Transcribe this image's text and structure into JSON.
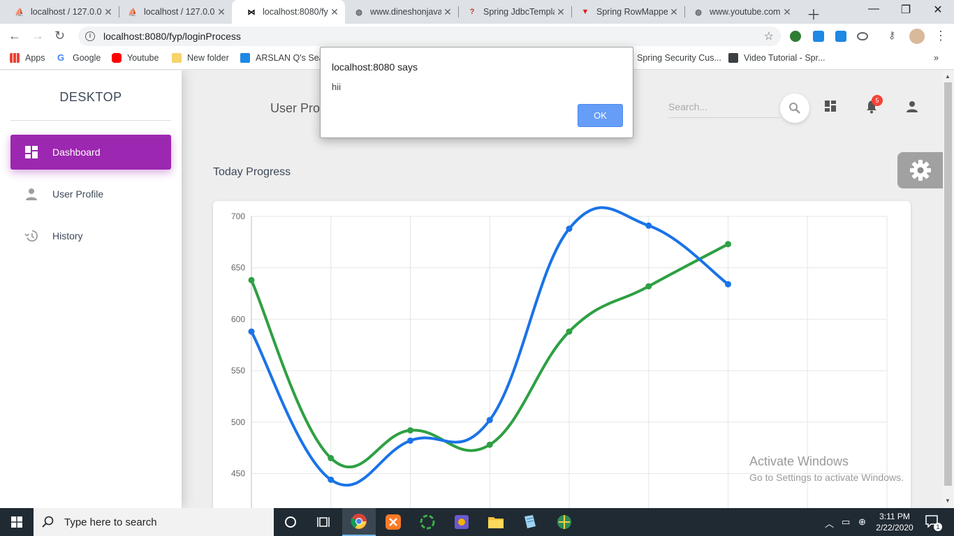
{
  "browser": {
    "tabs": [
      {
        "title": "localhost / 127.0.0",
        "favicon": "phpmyadmin-icon"
      },
      {
        "title": "localhost / 127.0.0",
        "favicon": "phpmyadmin-icon"
      },
      {
        "title": "localhost:8080/fyp",
        "favicon": "bowtie-icon"
      },
      {
        "title": "www.dineshonjava",
        "favicon": "globe-icon"
      },
      {
        "title": "Spring JdbcTempla",
        "favicon": "question-icon"
      },
      {
        "title": "Spring RowMappe",
        "favicon": "vivaldi-icon"
      },
      {
        "title": "www.youtube.com",
        "favicon": "globe-icon"
      }
    ],
    "url": "localhost:8080/fyp/loginProcess",
    "bookmarks": [
      {
        "label": "Apps"
      },
      {
        "label": "Google"
      },
      {
        "label": "Youtube"
      },
      {
        "label": "New folder"
      },
      {
        "label": "ARSLAN Q's Sear"
      },
      {
        "label": "Spring Security Cus..."
      },
      {
        "label": "Video Tutorial - Spr..."
      }
    ]
  },
  "sidebar": {
    "brand": "DESKTOP",
    "items": [
      {
        "label": "Dashboard",
        "icon": "dashboard-icon",
        "active": true
      },
      {
        "label": "User Profile",
        "icon": "person-icon",
        "active": false
      },
      {
        "label": "History",
        "icon": "history-icon",
        "active": false
      }
    ]
  },
  "header": {
    "title": "User Prof",
    "search_placeholder": "Search...",
    "notification_count": "5"
  },
  "main": {
    "section_title": "Today Progress"
  },
  "chart_data": {
    "type": "line",
    "title": "",
    "xlabel": "",
    "ylabel": "",
    "ylim": [
      430,
      700
    ],
    "yticks": [
      700,
      650,
      600,
      550,
      500,
      450
    ],
    "grid": true,
    "series": [
      {
        "color": "#1a73e8",
        "values": [
          588,
          444,
          482,
          502,
          688,
          691,
          634
        ]
      },
      {
        "color": "#2ea043",
        "values": [
          638,
          465,
          492,
          478,
          588,
          632,
          673
        ]
      }
    ]
  },
  "alert": {
    "title": "localhost:8080 says",
    "message": "hii",
    "ok_label": "OK"
  },
  "watermark": {
    "line1": "Activate Windows",
    "line2": "Go to Settings to activate Windows."
  },
  "taskbar": {
    "search_text": "Type here to search",
    "time": "3:11 PM",
    "date": "2/22/2020",
    "notification_count": "1"
  }
}
